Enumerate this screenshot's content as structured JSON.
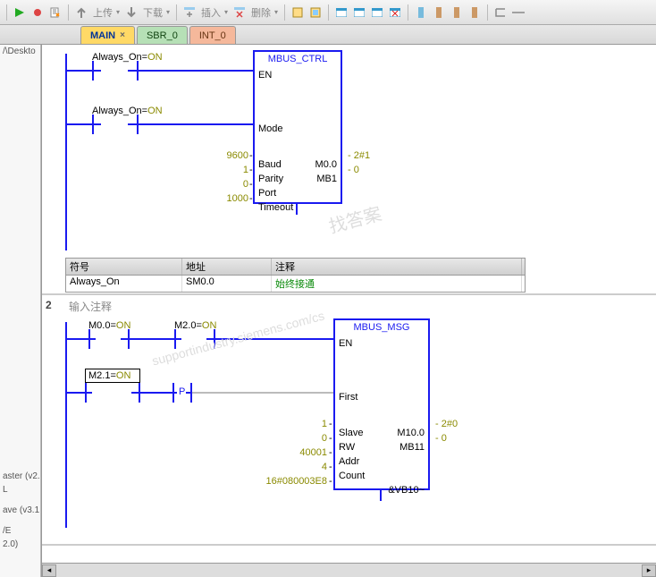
{
  "toolbar": {
    "upload": "上传",
    "download": "下载",
    "insert": "插入",
    "delete": "删除"
  },
  "tabs": {
    "main": "MAIN",
    "sbr": "SBR_0",
    "int": "INT_0"
  },
  "left": {
    "path": "/\\Deskto",
    "i1": "aster (v2.",
    "i2": "L",
    "i3": "ave (v3.1",
    "i4": "/E",
    "i5": "2.0)"
  },
  "rung1": {
    "always_on_a": "Always_On=",
    "on_a": "ON",
    "always_on_b": "Always_On=",
    "on_b": "ON",
    "block_title": "MBUS_CTRL",
    "pins": {
      "en": "EN",
      "mode": "Mode",
      "baud": "Baud",
      "parity": "Parity",
      "port": "Port",
      "timeout": "Timeout"
    },
    "vals": {
      "baud": "9600",
      "parity": "1",
      "port": "0",
      "timeout": "1000"
    },
    "outs": {
      "m00": "M0.0",
      "m00v": "2#1",
      "mb1": "MB1",
      "mb1v": "0"
    },
    "sym": {
      "h_sym": "符号",
      "h_addr": "地址",
      "h_cmt": "注释",
      "name": "Always_On",
      "addr": "SM0.0",
      "cmt": "始终接通"
    }
  },
  "rung2": {
    "num": "2",
    "comment": "输入注释",
    "m00": "M0.0=",
    "m20": "M2.0=",
    "m21": "M2.1=",
    "on": "ON",
    "p": "P",
    "block_title": "MBUS_MSG",
    "pins": {
      "en": "EN",
      "first": "First",
      "slave": "Slave",
      "rw": "RW",
      "addr": "Addr",
      "count": "Count",
      "dataptr": ""
    },
    "vals": {
      "slave": "1",
      "rw": "0",
      "addr": "40001",
      "count": "4",
      "dataptr": "16#080003E8"
    },
    "outs": {
      "m100": "M10.0",
      "m100v": "2#0",
      "mb11": "MB11",
      "mb11v": "0",
      "vb10": "&VB10~"
    }
  }
}
